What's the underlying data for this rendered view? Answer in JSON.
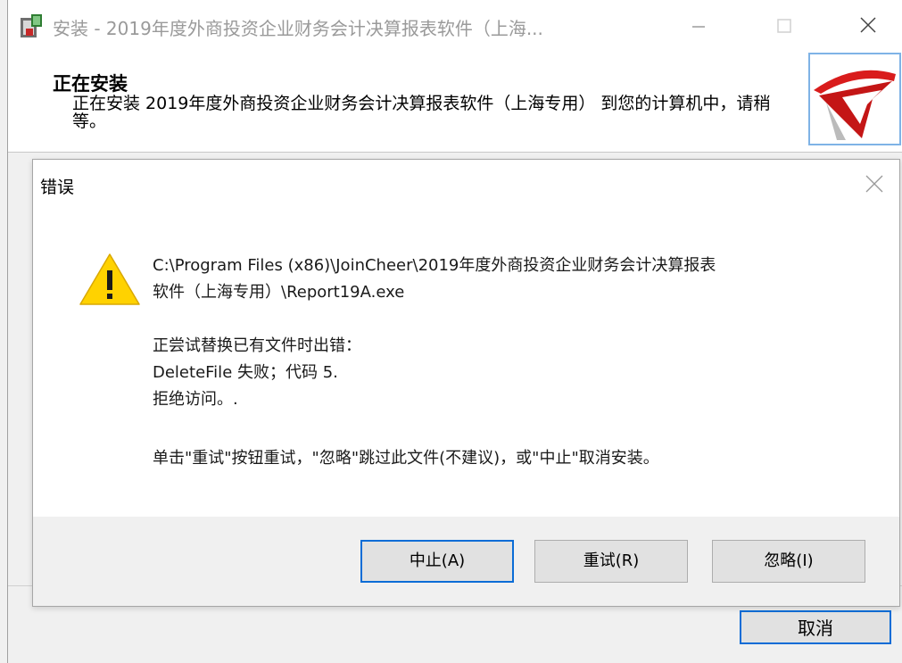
{
  "installer": {
    "title": "安装 - 2019年度外商投资企业财务会计决算报表软件（上海...",
    "heading": "正在安装",
    "description": "正在安装 2019年度外商投资企业财务会计决算报表软件（上海专用） 到您的计算机中，请稍等。",
    "cancel_label": "取消"
  },
  "error_dialog": {
    "title": "错误",
    "path_line1": "C:\\Program Files (x86)\\JoinCheer\\2019年度外商投资企业财务会计决算报表",
    "path_line2": "软件（上海专用）\\Report19A.exe",
    "error_line1": "正尝试替换已有文件时出错：",
    "error_line2": "DeleteFile 失败；代码 5.",
    "error_line3": "拒绝访问。.",
    "hint": "单击\"重试\"按钮重试，\"忽略\"跳过此文件(不建议)，或\"中止\"取消安装。",
    "buttons": {
      "abort": "中止(A)",
      "retry": "重试(R)",
      "ignore": "忽略(I)"
    }
  },
  "colors": {
    "accent_border": "#0a6cd6",
    "warning_yellow": "#ffd200",
    "logo_red": "#d91c1c"
  }
}
